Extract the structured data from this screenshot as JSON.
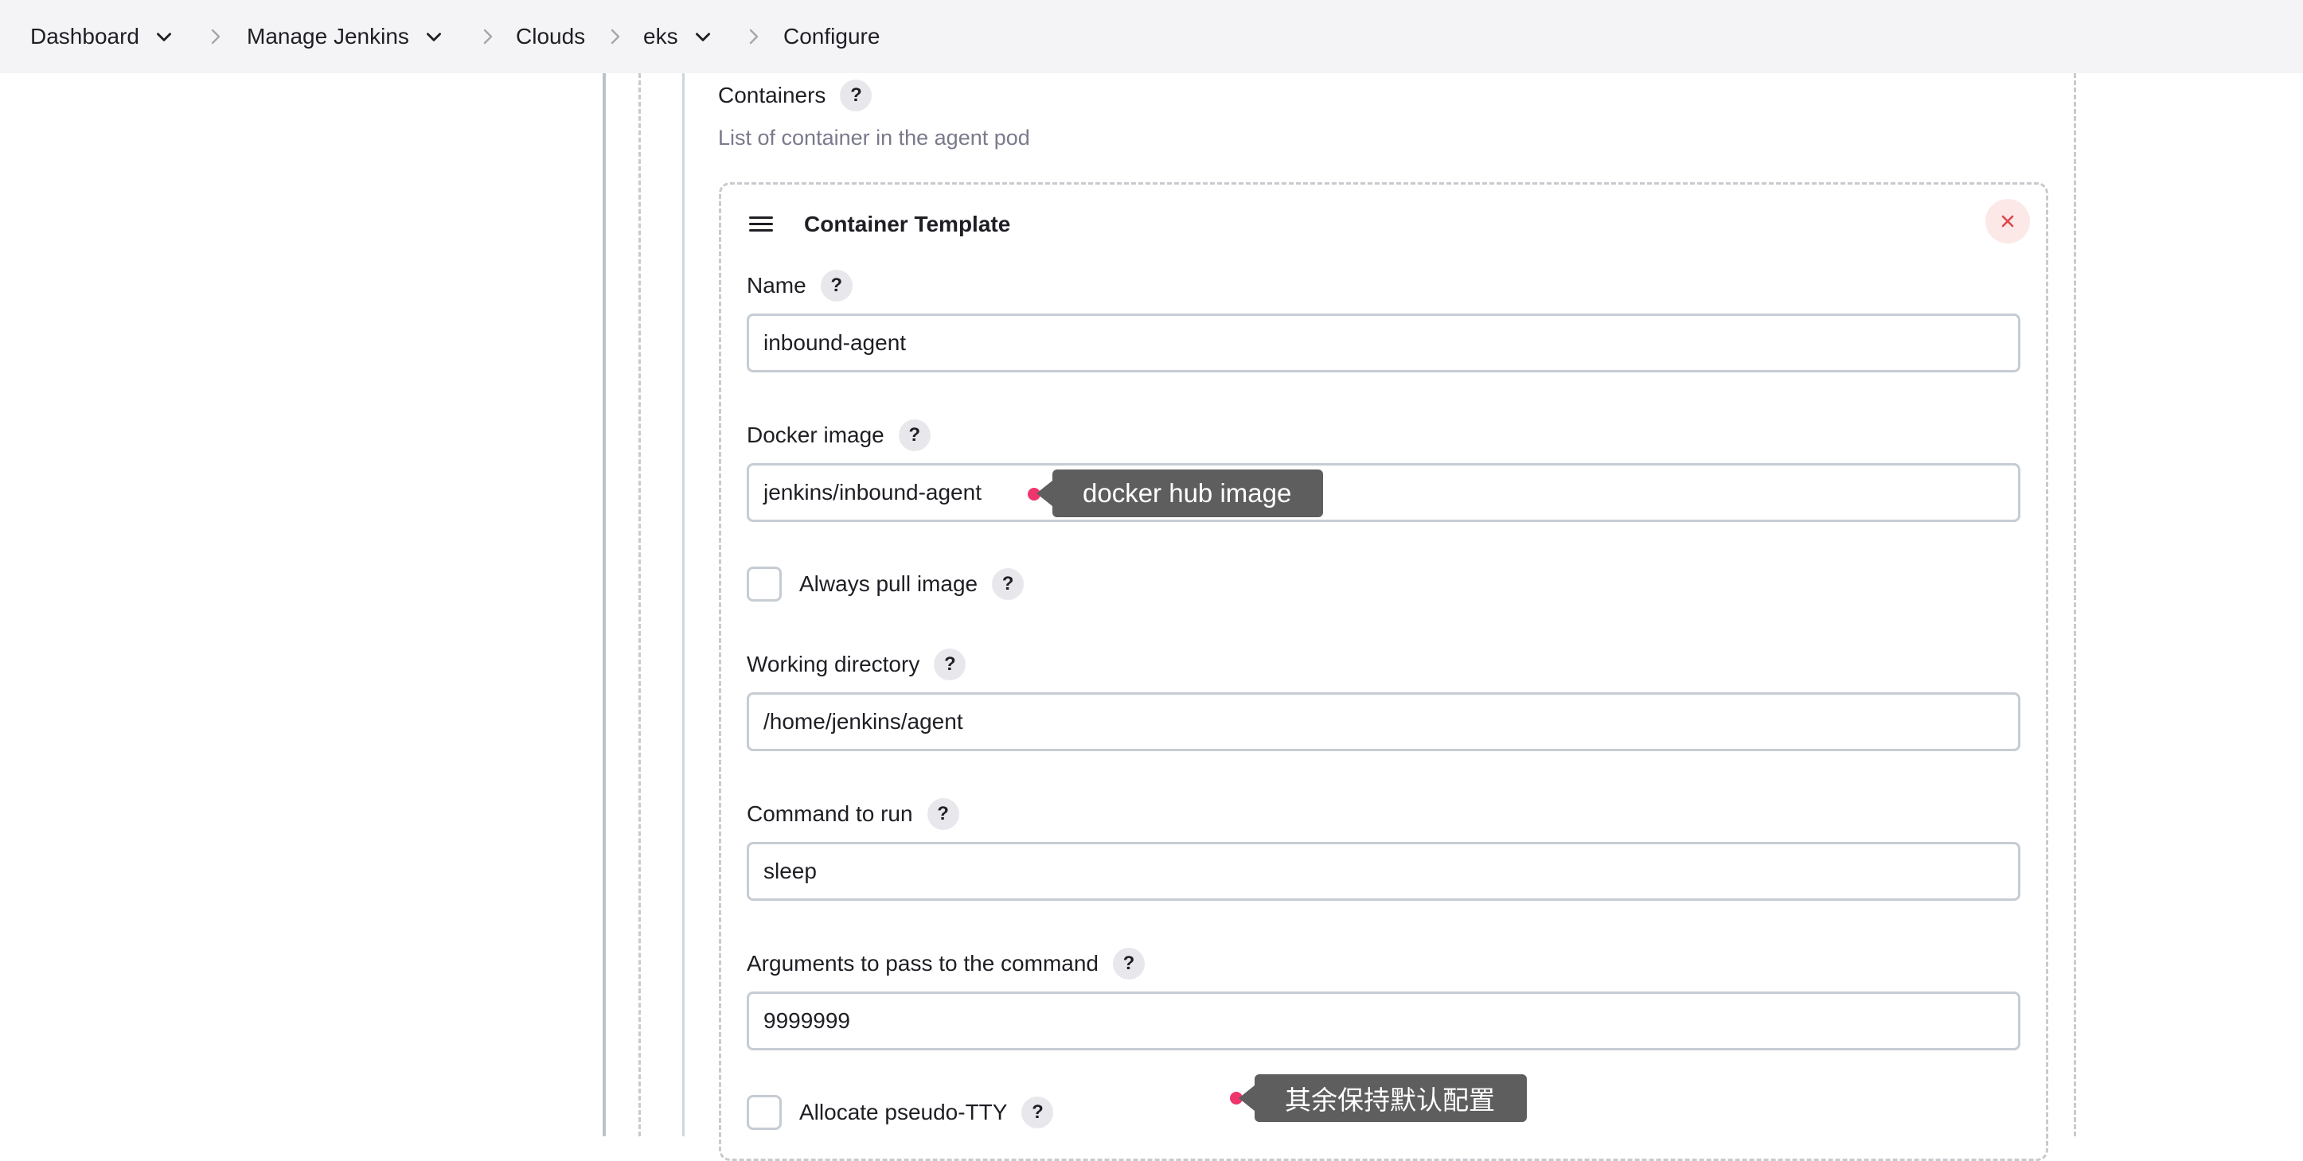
{
  "breadcrumb": {
    "items": [
      {
        "label": "Dashboard",
        "has_dropdown": true
      },
      {
        "label": "Manage Jenkins",
        "has_dropdown": true
      },
      {
        "label": "Clouds",
        "has_dropdown": false
      },
      {
        "label": "eks",
        "has_dropdown": true
      },
      {
        "label": "Configure",
        "has_dropdown": false
      }
    ]
  },
  "containers": {
    "label": "Containers",
    "description": "List of container in the agent pod",
    "help": "?"
  },
  "container_template": {
    "title": "Container Template",
    "remove_icon": "close-icon",
    "drag_icon": "hamburger-icon",
    "fields": {
      "name": {
        "label": "Name",
        "value": "inbound-agent"
      },
      "docker_image": {
        "label": "Docker image",
        "value": "jenkins/inbound-agent"
      },
      "always_pull": {
        "label": "Always pull image",
        "checked": false
      },
      "working_dir": {
        "label": "Working directory",
        "value": "/home/jenkins/agent"
      },
      "command": {
        "label": "Command to run",
        "value": "sleep"
      },
      "args": {
        "label": "Arguments to pass to the command",
        "value": "9999999"
      },
      "pseudo_tty": {
        "label": "Allocate pseudo-TTY",
        "checked": false
      }
    }
  },
  "annotations": {
    "docker_hub": "docker hub image",
    "defaults": "其余保持默认配置"
  },
  "colors": {
    "topbar_bg": "#f4f4f7",
    "annotation_dot": "#f0356c",
    "annotation_bg": "#5e5e5e",
    "close_bg": "#fde8e8",
    "close_icon": "#e0464a"
  }
}
